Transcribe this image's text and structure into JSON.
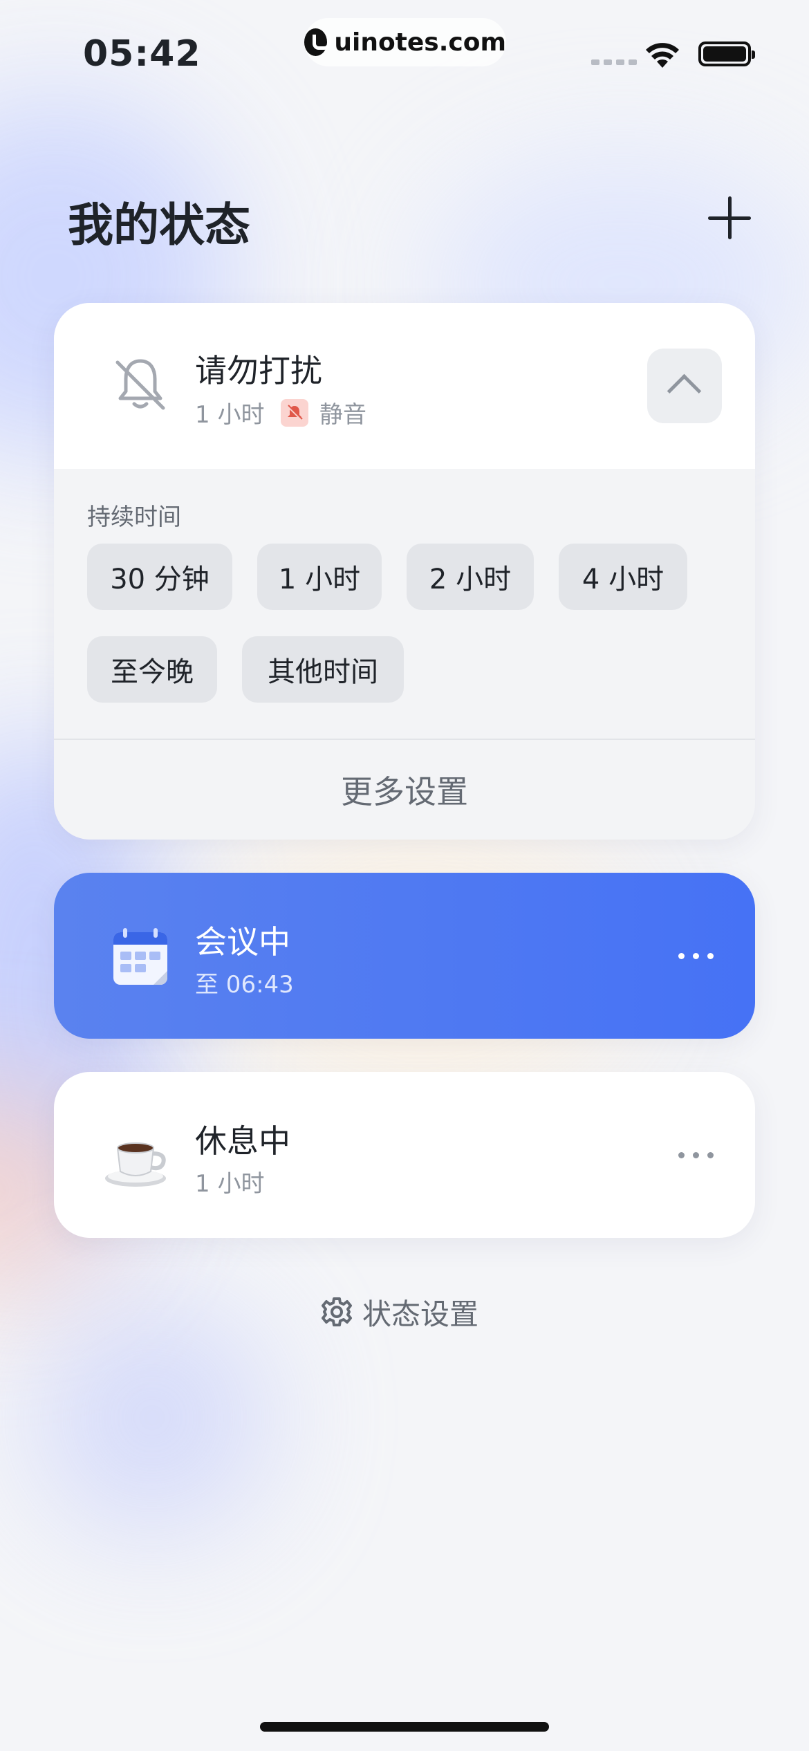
{
  "status_bar": {
    "time": "05:42",
    "url": "uinotes.com"
  },
  "header": {
    "title": "我的状态",
    "add_icon": "plus-icon"
  },
  "dnd_card": {
    "icon": "bell-slash-icon",
    "title": "请勿打扰",
    "duration": "1 小时",
    "mute_label": "静音",
    "duration_section_label": "持续时间",
    "duration_options": [
      "30 分钟",
      "1 小时",
      "2 小时",
      "4 小时",
      "至今晚",
      "其他时间"
    ],
    "more_settings": "更多设置"
  },
  "meeting_card": {
    "icon": "calendar-icon",
    "title": "会议中",
    "subtitle": "至 06:43",
    "accent": "#4F79F2"
  },
  "rest_card": {
    "icon": "coffee-icon",
    "title": "休息中",
    "subtitle": "1 小时"
  },
  "footer": {
    "status_settings": "状态设置"
  }
}
